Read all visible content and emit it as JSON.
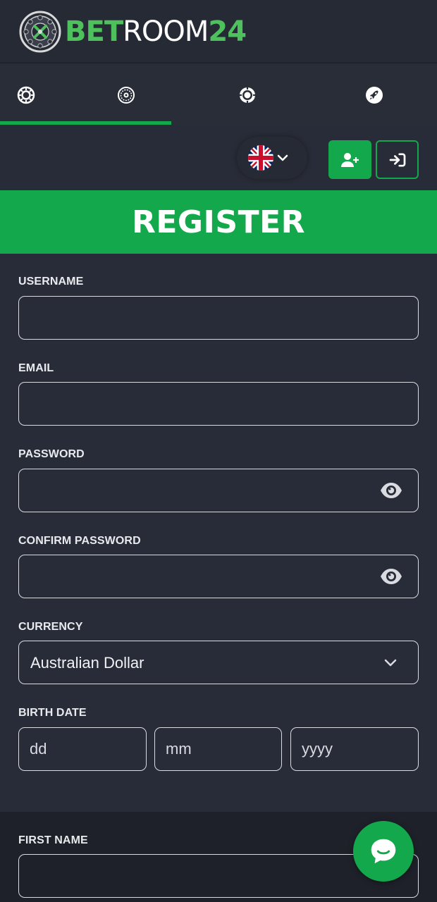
{
  "brand": {
    "bet": "BET",
    "room": "ROOM",
    "num": "24"
  },
  "tabs": [
    {
      "icon": "casino-chip-icon"
    },
    {
      "icon": "roulette-icon"
    },
    {
      "icon": "live-chip-icon"
    },
    {
      "icon": "rocket-icon"
    }
  ],
  "toolbar": {
    "language_icon": "uk-flag-icon",
    "signup_icon": "user-plus-icon",
    "login_icon": "sign-in-icon"
  },
  "register": {
    "title": "REGISTER"
  },
  "form": {
    "username_label": "USERNAME",
    "email_label": "EMAIL",
    "password_label": "PASSWORD",
    "confirm_password_label": "CONFIRM PASSWORD",
    "currency_label": "CURRENCY",
    "currency_value": "Australian Dollar",
    "birth_date_label": "BIRTH DATE",
    "day_placeholder": "dd",
    "month_placeholder": "mm",
    "year_placeholder": "yyyy",
    "first_name_label": "FIRST NAME"
  },
  "colors": {
    "accent": "#14a84d",
    "background": "#282c38",
    "logo_green": "#4cc15c"
  }
}
